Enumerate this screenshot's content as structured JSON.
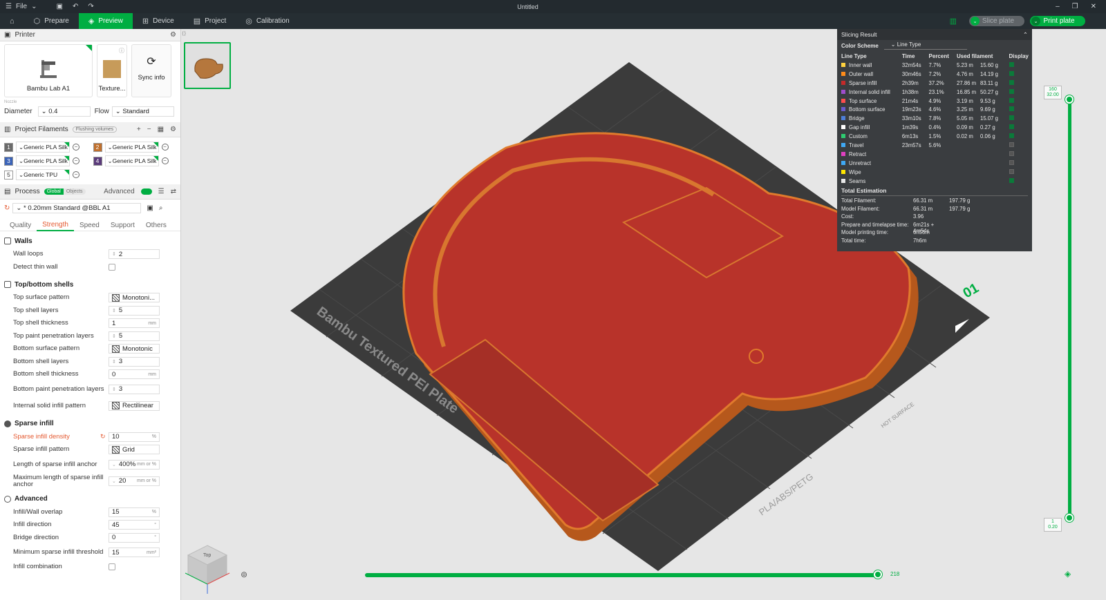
{
  "titlebar": {
    "menu": "File",
    "title": "Untitled"
  },
  "nav": {
    "home_icon": "home-icon",
    "tabs": [
      {
        "label": "Prepare",
        "icon": "cube-icon"
      },
      {
        "label": "Preview",
        "icon": "layers-icon"
      },
      {
        "label": "Device",
        "icon": "device-icon"
      },
      {
        "label": "Project",
        "icon": "project-icon"
      },
      {
        "label": "Calibration",
        "icon": "calibration-icon"
      }
    ],
    "active_tab": "Preview",
    "slice_label": "Slice plate",
    "print_label": "Print plate"
  },
  "printer": {
    "heading": "Printer",
    "printer_name": "Bambu Lab A1",
    "plate": "Texture...",
    "sync": "Sync info",
    "nozzle_label": "Nozzle",
    "diameter_label": "Diameter",
    "diameter": "0.4",
    "flow_label": "Flow",
    "flow": "Standard"
  },
  "filaments": {
    "heading": "Project Filaments",
    "flushing": "Flushing volumes",
    "items": [
      {
        "num": "1",
        "name": "Generic PLA Silk",
        "color": "#6b6b6b"
      },
      {
        "num": "2",
        "name": "Generic PLA Silk",
        "color": "#c0702d"
      },
      {
        "num": "3",
        "name": "Generic PLA Silk",
        "color": "#3b63b7"
      },
      {
        "num": "4",
        "name": "Generic PLA Silk",
        "color": "#5a3a7a"
      },
      {
        "num": "5",
        "name": "Generic TPU",
        "color": "#ffffff"
      }
    ]
  },
  "process": {
    "heading": "Process",
    "global": "Global",
    "objects": "Objects",
    "advanced": "Advanced",
    "preset": "* 0.20mm Standard @BBL A1",
    "tabs": [
      "Quality",
      "Strength",
      "Speed",
      "Support",
      "Others"
    ],
    "active_tab": "Strength"
  },
  "walls": {
    "title": "Walls",
    "wall_loops_label": "Wall loops",
    "wall_loops": "2",
    "thin_wall_label": "Detect thin wall"
  },
  "shells": {
    "title": "Top/bottom shells",
    "rows": [
      {
        "label": "Top surface pattern",
        "value": "Monotoni...",
        "pattern": true
      },
      {
        "label": "Top shell layers",
        "value": "5"
      },
      {
        "label": "Top shell thickness",
        "value": "1",
        "unit": "mm"
      },
      {
        "label": "Top paint penetration layers",
        "value": "5"
      },
      {
        "label": "Bottom surface pattern",
        "value": "Monotonic",
        "pattern": true
      },
      {
        "label": "Bottom shell layers",
        "value": "3"
      },
      {
        "label": "Bottom shell thickness",
        "value": "0",
        "unit": "mm"
      },
      {
        "label": "Bottom paint penetration layers",
        "value": "3"
      },
      {
        "label": "Internal solid infill pattern",
        "value": "Rectilinear",
        "pattern": true
      }
    ]
  },
  "sparse": {
    "title": "Sparse infill",
    "rows": [
      {
        "label": "Sparse infill density",
        "value": "10",
        "unit": "%"
      },
      {
        "label": "Sparse infill pattern",
        "value": "Grid",
        "pattern": true
      },
      {
        "label": "Length of sparse infill anchor",
        "value": "400%",
        "unit": "mm or %"
      },
      {
        "label": "Maximum length of sparse infill anchor",
        "value": "20",
        "unit": "mm or %"
      }
    ]
  },
  "advanced_grp": {
    "title": "Advanced",
    "rows": [
      {
        "label": "Infill/Wall overlap",
        "value": "15",
        "unit": "%"
      },
      {
        "label": "Infill direction",
        "value": "45",
        "unit": "°"
      },
      {
        "label": "Bridge direction",
        "value": "0",
        "unit": "°"
      },
      {
        "label": "Minimum sparse infill threshold",
        "value": "15",
        "unit": "mm²"
      },
      {
        "label": "Infill combination",
        "value": ""
      }
    ]
  },
  "slicing": {
    "title": "Slicing Result",
    "color_scheme_label": "Color Scheme",
    "color_scheme": "Line Type",
    "headers": [
      "Line Type",
      "Time",
      "Percent",
      "Used filament",
      "Display"
    ],
    "rows": [
      {
        "type": "Inner wall",
        "color": "#ffd23f",
        "time": "32m54s",
        "percent": "7.7%",
        "len": "5.23 m",
        "weight": "15.60 g",
        "shown": true
      },
      {
        "type": "Outer wall",
        "color": "#ff8c1a",
        "time": "30m46s",
        "percent": "7.2%",
        "len": "4.76 m",
        "weight": "14.19 g",
        "shown": true
      },
      {
        "type": "Sparse infill",
        "color": "#c42a2a",
        "time": "2h39m",
        "percent": "37.2%",
        "len": "27.86 m",
        "weight": "83.11 g",
        "shown": true
      },
      {
        "type": "Internal solid infill",
        "color": "#a04dcc",
        "time": "1h38m",
        "percent": "23.1%",
        "len": "16.85 m",
        "weight": "50.27 g",
        "shown": true
      },
      {
        "type": "Top surface",
        "color": "#ff4d4d",
        "time": "21m4s",
        "percent": "4.9%",
        "len": "3.19 m",
        "weight": "9.53 g",
        "shown": true
      },
      {
        "type": "Bottom surface",
        "color": "#6a5acd",
        "time": "19m23s",
        "percent": "4.6%",
        "len": "3.25 m",
        "weight": "9.69 g",
        "shown": true
      },
      {
        "type": "Bridge",
        "color": "#4d7fd9",
        "time": "33m10s",
        "percent": "7.8%",
        "len": "5.05 m",
        "weight": "15.07 g",
        "shown": true
      },
      {
        "type": "Gap infill",
        "color": "#ffffff",
        "time": "1m39s",
        "percent": "0.4%",
        "len": "0.09 m",
        "weight": "0.27 g",
        "shown": true
      },
      {
        "type": "Custom",
        "color": "#2ecc71",
        "time": "6m13s",
        "percent": "1.5%",
        "len": "0.02 m",
        "weight": "0.06 g",
        "shown": true
      },
      {
        "type": "Travel",
        "color": "#3fa9f5",
        "time": "23m57s",
        "percent": "5.6%",
        "len": "",
        "weight": "",
        "shown": false
      },
      {
        "type": "Retract",
        "color": "#e040c0",
        "time": "",
        "percent": "",
        "len": "",
        "weight": "",
        "shown": false
      },
      {
        "type": "Unretract",
        "color": "#3fa9f5",
        "time": "",
        "percent": "",
        "len": "",
        "weight": "",
        "shown": false
      },
      {
        "type": "Wipe",
        "color": "#ffe600",
        "time": "",
        "percent": "",
        "len": "",
        "weight": "",
        "shown": false
      },
      {
        "type": "Seams",
        "color": "#e8e8e8",
        "time": "",
        "percent": "",
        "len": "",
        "weight": "",
        "shown": true
      }
    ],
    "totals_title": "Total Estimation",
    "totals": [
      {
        "k": "Total Filament:",
        "v": "66.31 m",
        "w": "197.79 g"
      },
      {
        "k": "Model Filament:",
        "v": "66.31 m",
        "w": "197.79 g"
      },
      {
        "k": "Cost:",
        "v": "3.96",
        "w": ""
      },
      {
        "k": "Prepare and timelapse time:",
        "v": "6m21s + 4m54s",
        "w": ""
      },
      {
        "k": "Model printing time:",
        "v": "6h55m",
        "w": ""
      },
      {
        "k": "Total time:",
        "v": "7h6m",
        "w": ""
      }
    ]
  },
  "viewport": {
    "plate_text": "Bambu Textured PEI Plate",
    "plate_num": "01",
    "plate_marks": "PLA/ABS/PETG",
    "hot": "HOT SURFACE",
    "view_cube": "Top",
    "top_layer": "160",
    "top_height": "32.00",
    "bottom_layer": "1",
    "bottom_height": "0.20",
    "move_count": "218"
  }
}
